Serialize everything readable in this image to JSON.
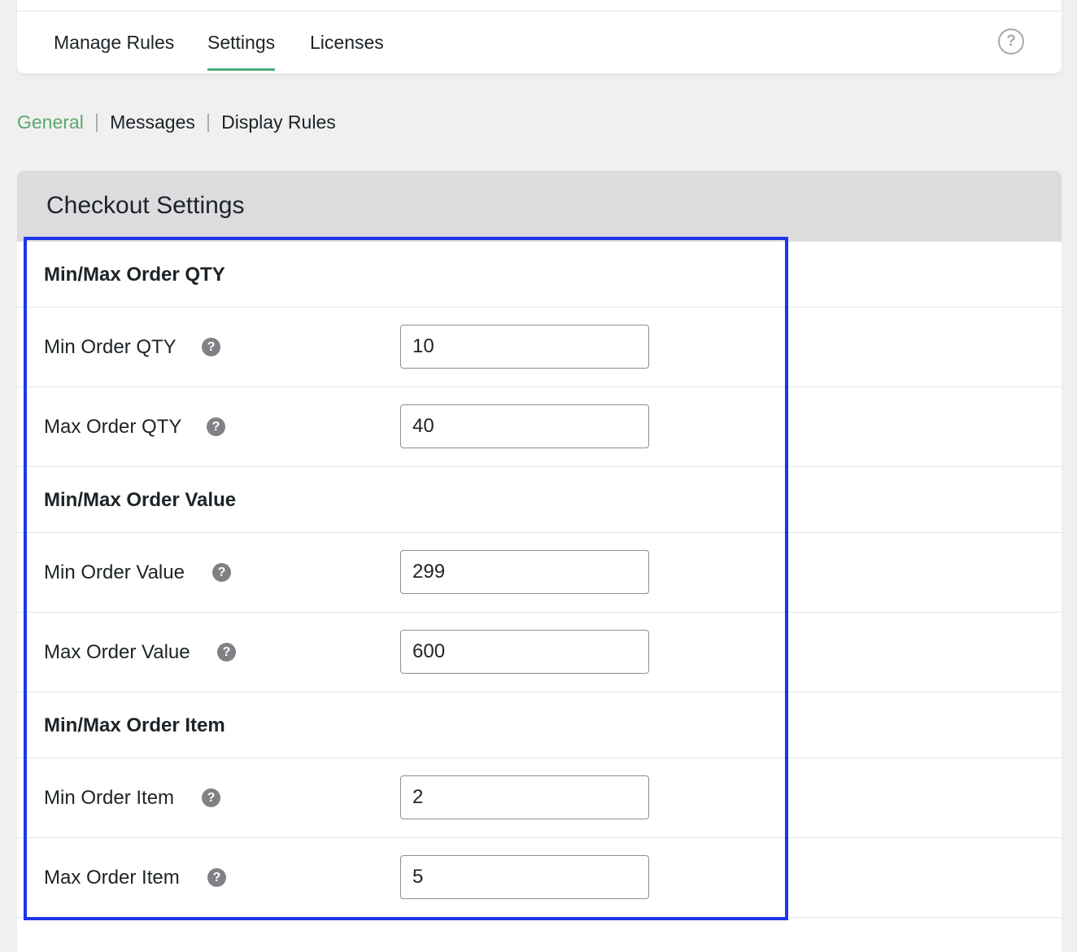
{
  "top_tabs": [
    {
      "label": "Manage Rules"
    },
    {
      "label": "Settings"
    },
    {
      "label": "Licenses"
    }
  ],
  "help": {
    "icon": "question-circle-icon",
    "symbol": "?"
  },
  "subnav": {
    "items": [
      {
        "label": "General"
      },
      {
        "label": "Messages"
      },
      {
        "label": "Display Rules"
      }
    ],
    "separator": "|"
  },
  "panel": {
    "title": "Checkout Settings"
  },
  "sections": [
    {
      "title": "Min/Max Order QTY",
      "fields": [
        {
          "label": "Min Order QTY",
          "value": "10"
        },
        {
          "label": "Max Order QTY",
          "value": "40"
        }
      ]
    },
    {
      "title": "Min/Max Order Value",
      "fields": [
        {
          "label": "Min Order Value",
          "value": "299"
        },
        {
          "label": "Max Order Value",
          "value": "600"
        }
      ]
    },
    {
      "title": "Min/Max Order Item",
      "fields": [
        {
          "label": "Min Order Item",
          "value": "2"
        },
        {
          "label": "Max Order Item",
          "value": "5"
        }
      ]
    }
  ],
  "tooltip_icon": {
    "name": "question-mark-icon",
    "symbol": "?"
  },
  "colors": {
    "accent": "#5aa86a",
    "highlight": "#1d35ef"
  }
}
